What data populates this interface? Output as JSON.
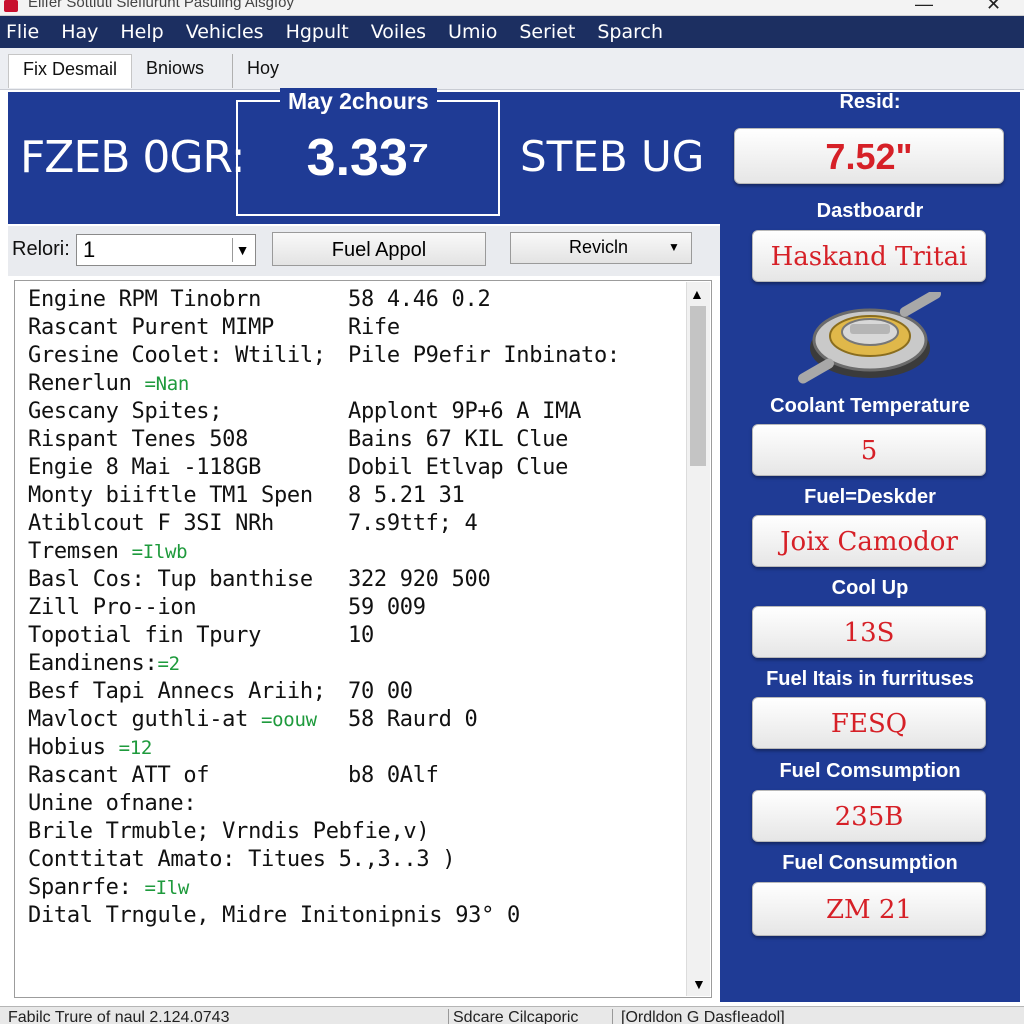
{
  "window": {
    "title": "Elifer Sottluti Sleflurunt Pasuling Alsgfoy",
    "minimize_glyph": "—",
    "close_glyph": "✕"
  },
  "menu": [
    "Flie",
    "Hay",
    "Help",
    "Vehicles",
    "Hgpult",
    "Voiles",
    "Umio",
    "Seriet",
    "Sparch"
  ],
  "tabs": [
    "Fix Desmail",
    "Bniows",
    "Hoy"
  ],
  "header": {
    "left_text": "FZEB 0GR:",
    "center_title": "May 2chours",
    "center_value": "3.33⁷",
    "right_text": "STEB UG"
  },
  "right_panel": {
    "items": [
      {
        "label": "Resid:",
        "value": "7.52\""
      },
      {
        "label": "Dastboardr",
        "value": "Haskand Tritai"
      },
      {
        "label": "Coolant Temperature",
        "value": "5"
      },
      {
        "label": "Fuel=Deskder",
        "value": "Joix Camodor"
      },
      {
        "label": "Cool Up",
        "value": "13S"
      },
      {
        "label": "Fuel Itais in furrituses",
        "value": "FESQ"
      },
      {
        "label": "Fuel Comsumption",
        "value": "235B"
      },
      {
        "label": "Fuel Consumption",
        "value": "ZM 21"
      }
    ],
    "icon": "fuel-cap-icon"
  },
  "controls": {
    "label": "Relori:",
    "select_value": "1",
    "button_label": "Fuel Appol",
    "select2_value": "Revicln"
  },
  "rows": [
    {
      "c1": "Engine RPM Tinobrn",
      "c2": "58 4.46 0.2"
    },
    {
      "c1": "Rascant Purent MIMP",
      "c2": "Rife"
    },
    {
      "c1": "Gresine Coolet: Wtilil;",
      "c2": "Pile P9efir Inbinato:"
    },
    {
      "c1": "Renerlun",
      "green": "=Nan"
    },
    {
      "c1": "Gescany Spites;",
      "c2": "Applont 9P+6 A IMA"
    },
    {
      "c1": "Rispant Tenes 508",
      "c2": "Bains 67 KIL Clue"
    },
    {
      "c1": "Engie 8 Mai -118GB",
      "c2": "Dobil Etlvap Clue"
    },
    {
      "c1": "Monty biiftle TM1 Spen",
      "c2": "8  5.21  31"
    },
    {
      "c1": "Atiblcout F 3SI NRh",
      "c2": "7.s9ttf; 4"
    },
    {
      "c1": "Tremsen",
      "green": "=Ilwb"
    },
    {
      "c1": "Basl Cos: Tup banthise",
      "c2": "322 920 500"
    },
    {
      "c1": "Zill Pro--ion",
      "c2": "59 009"
    },
    {
      "c1": "Topotial fin Tpury",
      "c2": "10"
    },
    {
      "c1": "Eandinens:",
      "green": "=2"
    },
    {
      "c1": "Besf Tapi Annecs Ariih;",
      "c2": "70 00"
    },
    {
      "c1": "Mavloct guthli-at",
      "green": "=oouw",
      "c2": "58 Raurd 0"
    },
    {
      "c1": "Hobius",
      "green": "=12"
    },
    {
      "c1": "Rascant ATT of",
      "c2": "b8 0Alf"
    },
    {
      "c1": "Unine ofnane:"
    },
    {
      "c1": "Brile Trmuble; Vrndis Pebfie,v)"
    },
    {
      "c1": "Conttitat Amato: Titues 5.,3..3 )"
    },
    {
      "c1": "Spanrfe:",
      "green": "=Ilw"
    },
    {
      "c1": "Dital Trngule, Midre Initonipnis 93° 0"
    }
  ],
  "status": [
    "Fabilc Trure of naul 2.124.0743",
    "Sdcare Cilcaporic",
    "[Ordldon G DasfIeadol]"
  ],
  "colors": {
    "menu_bg": "#1c2f61",
    "panel_blue": "#1f3b95",
    "value_red": "#d62027",
    "accent_green": "#1e9a3c"
  }
}
